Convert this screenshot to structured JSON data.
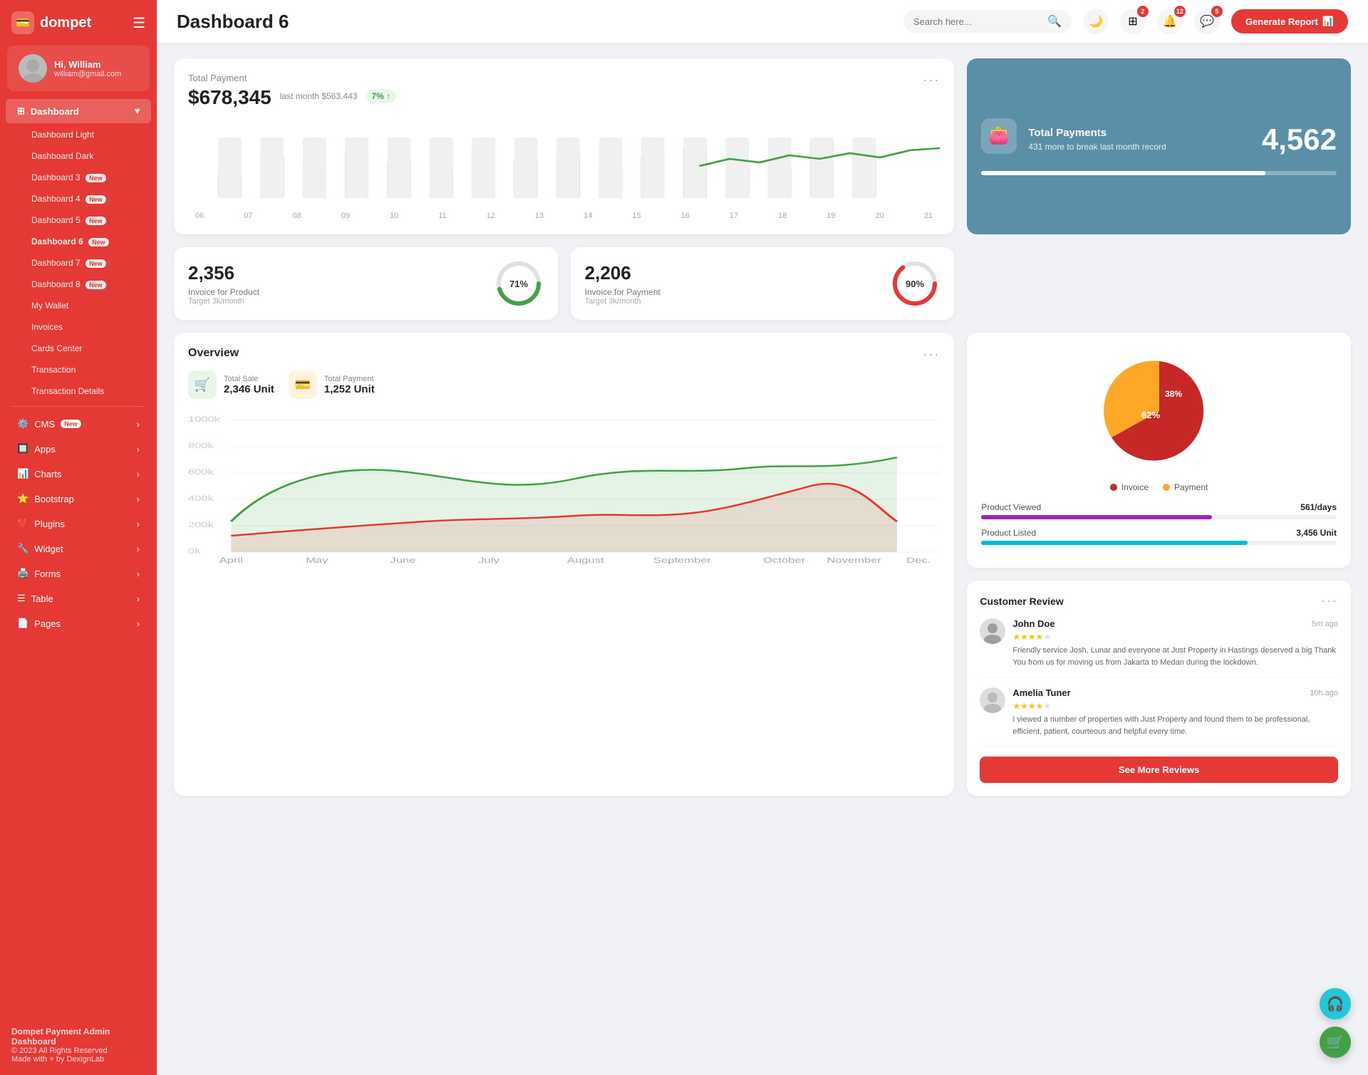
{
  "sidebar": {
    "logo": "dompet",
    "logo_icon": "💳",
    "user": {
      "name": "Hi, William",
      "email": "william@gmail.com"
    },
    "menu": {
      "dashboard_label": "Dashboard",
      "sub_items": [
        {
          "label": "Dashboard Light",
          "badge": ""
        },
        {
          "label": "Dashboard Dark",
          "badge": ""
        },
        {
          "label": "Dashboard 3",
          "badge": "New"
        },
        {
          "label": "Dashboard 4",
          "badge": "New"
        },
        {
          "label": "Dashboard 5",
          "badge": "New"
        },
        {
          "label": "Dashboard 6",
          "badge": "New",
          "active": true
        },
        {
          "label": "Dashboard 7",
          "badge": "New"
        },
        {
          "label": "Dashboard 8",
          "badge": "New"
        },
        {
          "label": "My Wallet",
          "badge": ""
        },
        {
          "label": "Invoices",
          "badge": ""
        },
        {
          "label": "Cards Center",
          "badge": ""
        },
        {
          "label": "Transaction",
          "badge": ""
        },
        {
          "label": "Transaction Details",
          "badge": ""
        }
      ],
      "main_items": [
        {
          "label": "CMS",
          "badge": "New",
          "icon": "⚙️"
        },
        {
          "label": "Apps",
          "badge": "",
          "icon": "🔲"
        },
        {
          "label": "Charts",
          "badge": "",
          "icon": "📊"
        },
        {
          "label": "Bootstrap",
          "badge": "",
          "icon": "⭐"
        },
        {
          "label": "Plugins",
          "badge": "",
          "icon": "❤️"
        },
        {
          "label": "Widget",
          "badge": "",
          "icon": "🔧"
        },
        {
          "label": "Forms",
          "badge": "",
          "icon": "🖨️"
        },
        {
          "label": "Table",
          "badge": "",
          "icon": "☰"
        },
        {
          "label": "Pages",
          "badge": "",
          "icon": "📄"
        }
      ]
    },
    "footer": {
      "brand": "Dompet Payment Admin Dashboard",
      "copyright": "© 2023 All Rights Reserved",
      "made_with": "Made with",
      "by": "by DexignLab"
    }
  },
  "header": {
    "title": "Dashboard 6",
    "search_placeholder": "Search here...",
    "notifications": {
      "apps_badge": "2",
      "bell_badge": "12",
      "chat_badge": "5"
    },
    "generate_btn": "Generate Report"
  },
  "total_payment": {
    "title": "Total Payment",
    "amount": "$678,345",
    "last_month": "last month $563,443",
    "growth": "7%",
    "more_icon": "···",
    "bars": [
      40,
      70,
      55,
      80,
      60,
      50,
      90,
      65,
      75,
      55,
      70,
      85,
      60,
      55,
      95,
      70
    ]
  },
  "blue_card": {
    "title": "Total Payments",
    "subtitle": "431 more to break last month record",
    "number": "4,562",
    "progress": 80
  },
  "invoice_product": {
    "number": "2,356",
    "label": "Invoice for Product",
    "target": "Target 3k/month",
    "percent": 71,
    "color": "#43a047"
  },
  "invoice_payment": {
    "number": "2,206",
    "label": "Invoice for Payment",
    "target": "Target 3k/month",
    "percent": 90,
    "color": "#e53935"
  },
  "overview": {
    "title": "Overview",
    "more_icon": "···",
    "total_sale": {
      "label": "Total Sale",
      "value": "2,346 Unit"
    },
    "total_payment": {
      "label": "Total Payment",
      "value": "1,252 Unit"
    },
    "y_labels": [
      "1000k",
      "800k",
      "600k",
      "400k",
      "200k",
      "0k"
    ],
    "x_labels": [
      "April",
      "May",
      "June",
      "July",
      "August",
      "September",
      "October",
      "November",
      "Dec."
    ]
  },
  "pie_chart": {
    "invoice_pct": 62,
    "payment_pct": 38,
    "invoice_label": "Invoice",
    "payment_label": "Payment",
    "invoice_color": "#c62828",
    "payment_color": "#ffa726"
  },
  "product_stats": {
    "viewed": {
      "label": "Product Viewed",
      "value": "561/days",
      "color": "#9c27b0",
      "percent": 65
    },
    "listed": {
      "label": "Product Listed",
      "value": "3,456 Unit",
      "color": "#00bcd4",
      "percent": 75
    }
  },
  "customer_review": {
    "title": "Customer Review",
    "more_icon": "···",
    "reviews": [
      {
        "name": "John Doe",
        "time": "5m ago",
        "stars": 4,
        "text": "Friendly service Josh, Lunar and everyone at Just Property in Hastings deserved a big Thank You from us for moving us from Jakarta to Medan during the lockdown."
      },
      {
        "name": "Amelia Tuner",
        "time": "10h ago",
        "stars": 4,
        "text": "I viewed a number of properties with Just Property and found them to be professional, efficient, patient, courteous and helpful every time."
      }
    ],
    "see_more": "See More Reviews"
  }
}
